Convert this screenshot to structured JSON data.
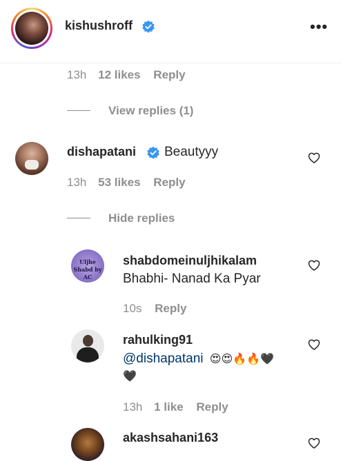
{
  "header": {
    "username": "kishushroff",
    "more_label": "•••"
  },
  "parent_meta": {
    "time": "13h",
    "likes": "12 likes",
    "reply": "Reply"
  },
  "view_replies": "View replies (1)",
  "comment": {
    "username": "dishapatani",
    "text": "Beautyyy",
    "time": "13h",
    "likes": "53 likes",
    "reply": "Reply"
  },
  "hide_replies": "Hide replies",
  "replies": [
    {
      "username": "shabdomeinuljhikalam",
      "text": "Bhabhi- Nanad Ka Pyar",
      "avatar_text": "Uljhe Shabd by AC",
      "time": "10s",
      "reply": "Reply"
    },
    {
      "username": "rahulking91",
      "mention": "@dishapatani",
      "emoji_line1": "😍😍🔥🔥🖤",
      "emoji_line2": "🖤",
      "time": "13h",
      "likes": "1 like",
      "reply": "Reply"
    },
    {
      "username": "akashsahani163"
    }
  ],
  "colors": {
    "verified": "#3897f0",
    "secondary_text": "#8e8e8e",
    "mention": "#00376b"
  }
}
